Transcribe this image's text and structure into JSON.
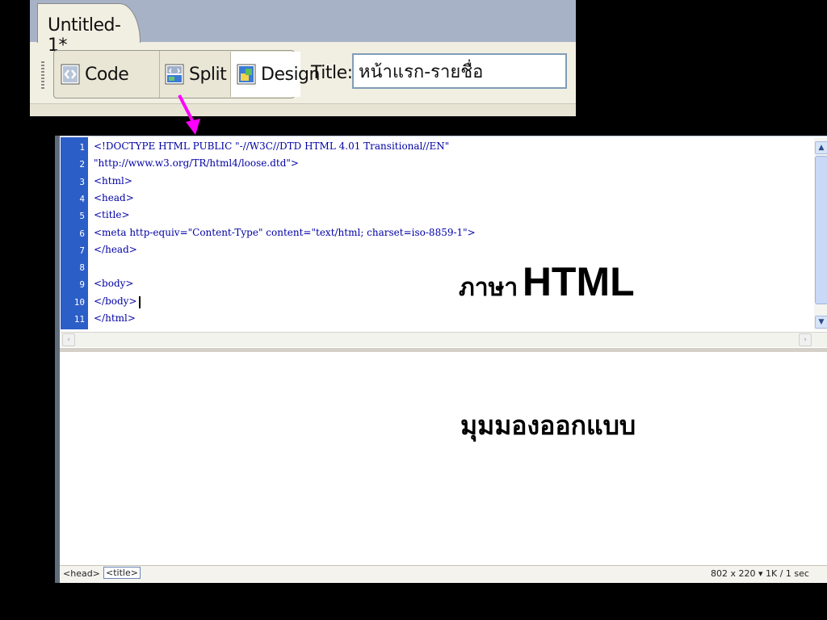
{
  "toolbar": {
    "document_tab": "Untitled-1*",
    "code_label": "Code",
    "split_label": "Split",
    "design_label": "Design",
    "title_label": "Title:",
    "title_value": "หน้าแรก-รายชื่อ"
  },
  "code_editor": {
    "lines": [
      {
        "num": "1",
        "text": "<!DOCTYPE HTML PUBLIC \"-//W3C//DTD HTML 4.01 Transitional//EN\""
      },
      {
        "num": "2",
        "text": "\"http://www.w3.org/TR/html4/loose.dtd\">"
      },
      {
        "num": "3",
        "text": "<html>"
      },
      {
        "num": "4",
        "text": "<head>"
      },
      {
        "num": "5",
        "text": "<title>"
      },
      {
        "num": "6",
        "text": "<meta http-equiv=\"Content-Type\" content=\"text/html; charset=iso-8859-1\">"
      },
      {
        "num": "7",
        "text": "</head>"
      },
      {
        "num": "8",
        "text": ""
      },
      {
        "num": "9",
        "text": "<body>"
      },
      {
        "num": "10",
        "text": "</body>"
      },
      {
        "num": "11",
        "text": "</html>"
      }
    ]
  },
  "status_bar": {
    "tag_head": "<head>",
    "tag_title": "<title>",
    "window_size": "802 x 220 ▾ 1K / 1 sec"
  },
  "annotations": {
    "code_view_thai": "ภาษา",
    "code_view_en": "HTML",
    "design_view": "มุมมองออกแบบ"
  },
  "colors": {
    "gutter": "#2c5ec7",
    "code_text": "#0000a5",
    "arrow": "#ff00ff",
    "background": "#000000"
  },
  "icons": [
    "code-view-icon",
    "split-view-icon",
    "design-view-icon",
    "scroll-up-icon",
    "scroll-down-icon",
    "scroll-left-icon",
    "scroll-right-icon"
  ]
}
